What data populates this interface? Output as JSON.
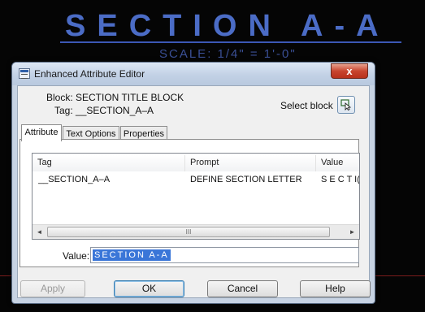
{
  "background": {
    "drawing_title": "SECTION A-A",
    "scale_text": "SCALE: 1/4\" = 1'-0\""
  },
  "window": {
    "title": "Enhanced Attribute Editor",
    "close_glyph": "x"
  },
  "block_info": {
    "block_label": "Block: SECTION TITLE BLOCK",
    "tag_label": "Tag: __SECTION_A–A",
    "select_block_label": "Select block"
  },
  "tabs": [
    {
      "label": "Attribute",
      "active": true
    },
    {
      "label": "Text Options",
      "active": false
    },
    {
      "label": "Properties",
      "active": false
    }
  ],
  "attribute_table": {
    "columns": [
      "Tag",
      "Prompt",
      "Value"
    ],
    "rows": [
      {
        "tag": "__SECTION_A–A",
        "prompt": "DEFINE SECTION LETTER",
        "value": "S E C T I("
      }
    ],
    "scroll_left_glyph": "◄",
    "scroll_right_glyph": "►",
    "scroll_grip": "III"
  },
  "value_field": {
    "label": "Value:",
    "value": "SECTION A-A"
  },
  "buttons": {
    "apply": "Apply",
    "ok": "OK",
    "cancel": "Cancel",
    "help": "Help"
  },
  "colors": {
    "cad_text": "#4b6cc6",
    "selection": "#3a76d8",
    "close_button": "#c8452e"
  },
  "icons": [
    "app-icon",
    "close-icon",
    "select-block-icon",
    "scroll-left-icon",
    "scroll-right-icon"
  ]
}
